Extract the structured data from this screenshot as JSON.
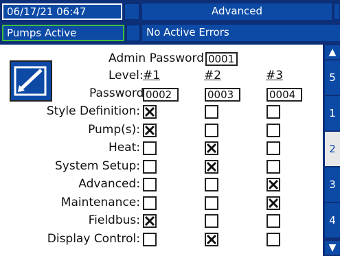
{
  "header": {
    "datetime": "06/17/21 06:47",
    "title": "Advanced",
    "status": "Pumps Active",
    "errors": "No Active Errors"
  },
  "admin": {
    "label": "Admin Password:",
    "value": "0001"
  },
  "levels": {
    "label": "Level:",
    "headers": [
      "#1",
      "#2",
      "#3"
    ],
    "password_label": "Password:",
    "passwords": [
      "0002",
      "0003",
      "0004"
    ]
  },
  "rows": [
    {
      "label": "Style Definition:",
      "checks": [
        true,
        false,
        false
      ]
    },
    {
      "label": "Pump(s):",
      "checks": [
        true,
        false,
        false
      ]
    },
    {
      "label": "Heat:",
      "checks": [
        false,
        true,
        false
      ]
    },
    {
      "label": "System Setup:",
      "checks": [
        false,
        true,
        false
      ]
    },
    {
      "label": "Advanced:",
      "checks": [
        false,
        false,
        true
      ]
    },
    {
      "label": "Maintenance:",
      "checks": [
        false,
        false,
        true
      ]
    },
    {
      "label": "Fieldbus:",
      "checks": [
        true,
        false,
        false
      ]
    },
    {
      "label": "Display Control:",
      "checks": [
        false,
        true,
        false
      ]
    }
  ],
  "pages": {
    "items": [
      "5",
      "1",
      "2",
      "3",
      "4"
    ],
    "selected": "2"
  },
  "icons": {
    "edit": "edit-pencil-icon",
    "up": "arrow-up-icon",
    "down": "arrow-down-icon"
  },
  "colors": {
    "accent": "#0c4aa6",
    "status_border": "#3fbf3f"
  }
}
